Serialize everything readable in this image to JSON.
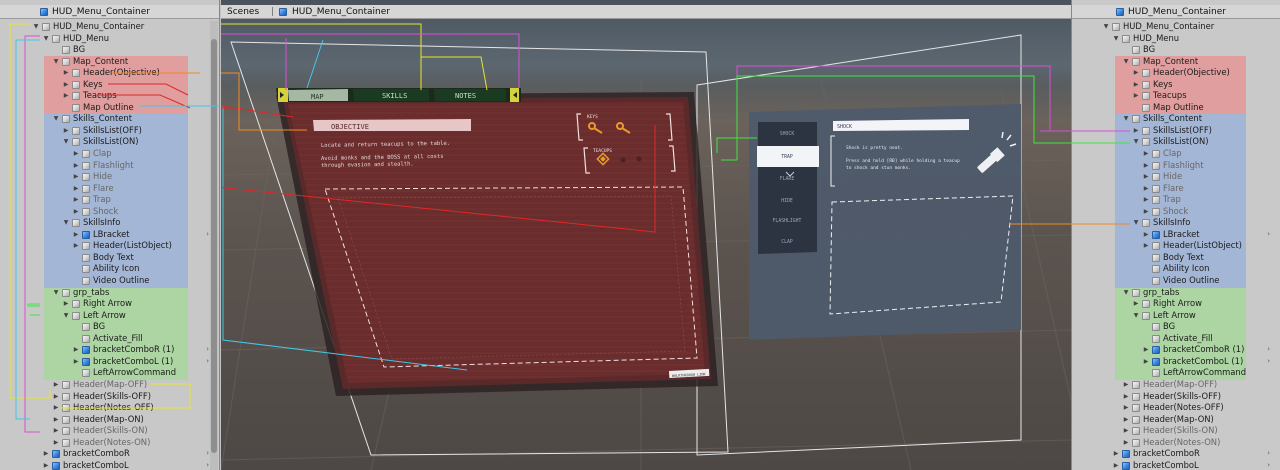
{
  "hierarchy_title": "HUD_Menu_Container",
  "scene_tab": "Scenes",
  "scene_title": "HUD_Menu_Container",
  "colors": {
    "map_group": "#e49696",
    "skills_group": "#a0b4d6",
    "tabs_group": "#aad6a0",
    "callout_yellow": "#e6e62a",
    "callout_magenta": "#d84fd8",
    "callout_cyan": "#3fc8e6",
    "callout_red": "#e02828",
    "callout_orange": "#f08a24",
    "callout_green": "#3fe63f"
  },
  "tree_items": [
    {
      "label": "HUD_Menu_Container",
      "depth": 0,
      "expanded": true
    },
    {
      "label": "HUD_Menu",
      "depth": 1,
      "expanded": true
    },
    {
      "label": "BG",
      "depth": 2
    },
    {
      "label": "Map_Content",
      "depth": 2,
      "expanded": true
    },
    {
      "label": "Header(Objective)",
      "depth": 3,
      "collapsed": true
    },
    {
      "label": "Keys",
      "depth": 3,
      "collapsed": true
    },
    {
      "label": "Teacups",
      "depth": 3,
      "collapsed": true
    },
    {
      "label": "Map Outline",
      "depth": 3
    },
    {
      "label": "Skills_Content",
      "depth": 2,
      "expanded": true
    },
    {
      "label": "SkillsList(OFF)",
      "depth": 3,
      "collapsed": true
    },
    {
      "label": "SkillsList(ON)",
      "depth": 3,
      "expanded": true
    },
    {
      "label": "Clap",
      "depth": 4,
      "collapsed": true,
      "dim": true
    },
    {
      "label": "Flashlight",
      "depth": 4,
      "collapsed": true,
      "dim": true
    },
    {
      "label": "Hide",
      "depth": 4,
      "collapsed": true,
      "dim": true
    },
    {
      "label": "Flare",
      "depth": 4,
      "collapsed": true,
      "dim": true
    },
    {
      "label": "Trap",
      "depth": 4,
      "collapsed": true,
      "dim": true
    },
    {
      "label": "Shock",
      "depth": 4,
      "collapsed": true,
      "dim": true
    },
    {
      "label": "SkillsInfo",
      "depth": 3,
      "expanded": true
    },
    {
      "label": "LBracket",
      "depth": 4,
      "collapsed": true,
      "blue": true,
      "chevron": true
    },
    {
      "label": "Header(ListObject)",
      "depth": 4,
      "collapsed": true
    },
    {
      "label": "Body Text",
      "depth": 4
    },
    {
      "label": "Ability Icon",
      "depth": 4
    },
    {
      "label": "Video Outline",
      "depth": 4
    },
    {
      "label": "grp_tabs",
      "depth": 2,
      "expanded": true
    },
    {
      "label": "Right Arrow",
      "depth": 3,
      "collapsed": true
    },
    {
      "label": "Left Arrow",
      "depth": 3,
      "expanded": true
    },
    {
      "label": "BG",
      "depth": 4
    },
    {
      "label": "Activate_Fill",
      "depth": 4
    },
    {
      "label": "bracketComboR (1)",
      "depth": 4,
      "collapsed": true,
      "blue": true,
      "chevron": true
    },
    {
      "label": "bracketComboL (1)",
      "depth": 4,
      "collapsed": true,
      "blue": true,
      "chevron": true
    },
    {
      "label": "LeftArrowCommand",
      "depth": 4
    },
    {
      "label": "Header(Map-OFF)",
      "depth": 2,
      "collapsed": true,
      "dim": true
    },
    {
      "label": "Header(Skills-OFF)",
      "depth": 2,
      "collapsed": true
    },
    {
      "label": "Header(Notes-OFF)",
      "depth": 2,
      "collapsed": true
    },
    {
      "label": "Header(Map-ON)",
      "depth": 2,
      "collapsed": true
    },
    {
      "label": "Header(Skills-ON)",
      "depth": 2,
      "collapsed": true,
      "dim": true
    },
    {
      "label": "Header(Notes-ON)",
      "depth": 2,
      "collapsed": true,
      "dim": true
    },
    {
      "label": "bracketComboR",
      "depth": 1,
      "collapsed": true,
      "blue": true,
      "chevron": true
    },
    {
      "label": "bracketComboL",
      "depth": 1,
      "collapsed": true,
      "blue": true,
      "chevron": true
    }
  ],
  "map_panel": {
    "tabs": [
      "MAP",
      "SKILLS",
      "NOTES"
    ],
    "objective_header": "OBJECTIVE",
    "objective_line1": "Locate and return teacups to the table.",
    "objective_line2": "Avoid monks and the BOSS at all costs",
    "objective_line3": "through evasion and stealth.",
    "keys_label": "KEYS",
    "teacups_label": "TEACUPS",
    "corner_note": "WALKTHROUGH LINK"
  },
  "skills_panel": {
    "skills": [
      "SHOCK",
      "TRAP",
      "FLARE",
      "HIDE",
      "FLASHLIGHT",
      "CLAP"
    ],
    "selected_skill": "TRAP",
    "header": "SHOCK",
    "body_line1": "Shock is pretty neat.",
    "body_line2": "Press and hold [RB] while holding a teacup",
    "body_line3": "to shock and stun monks."
  }
}
